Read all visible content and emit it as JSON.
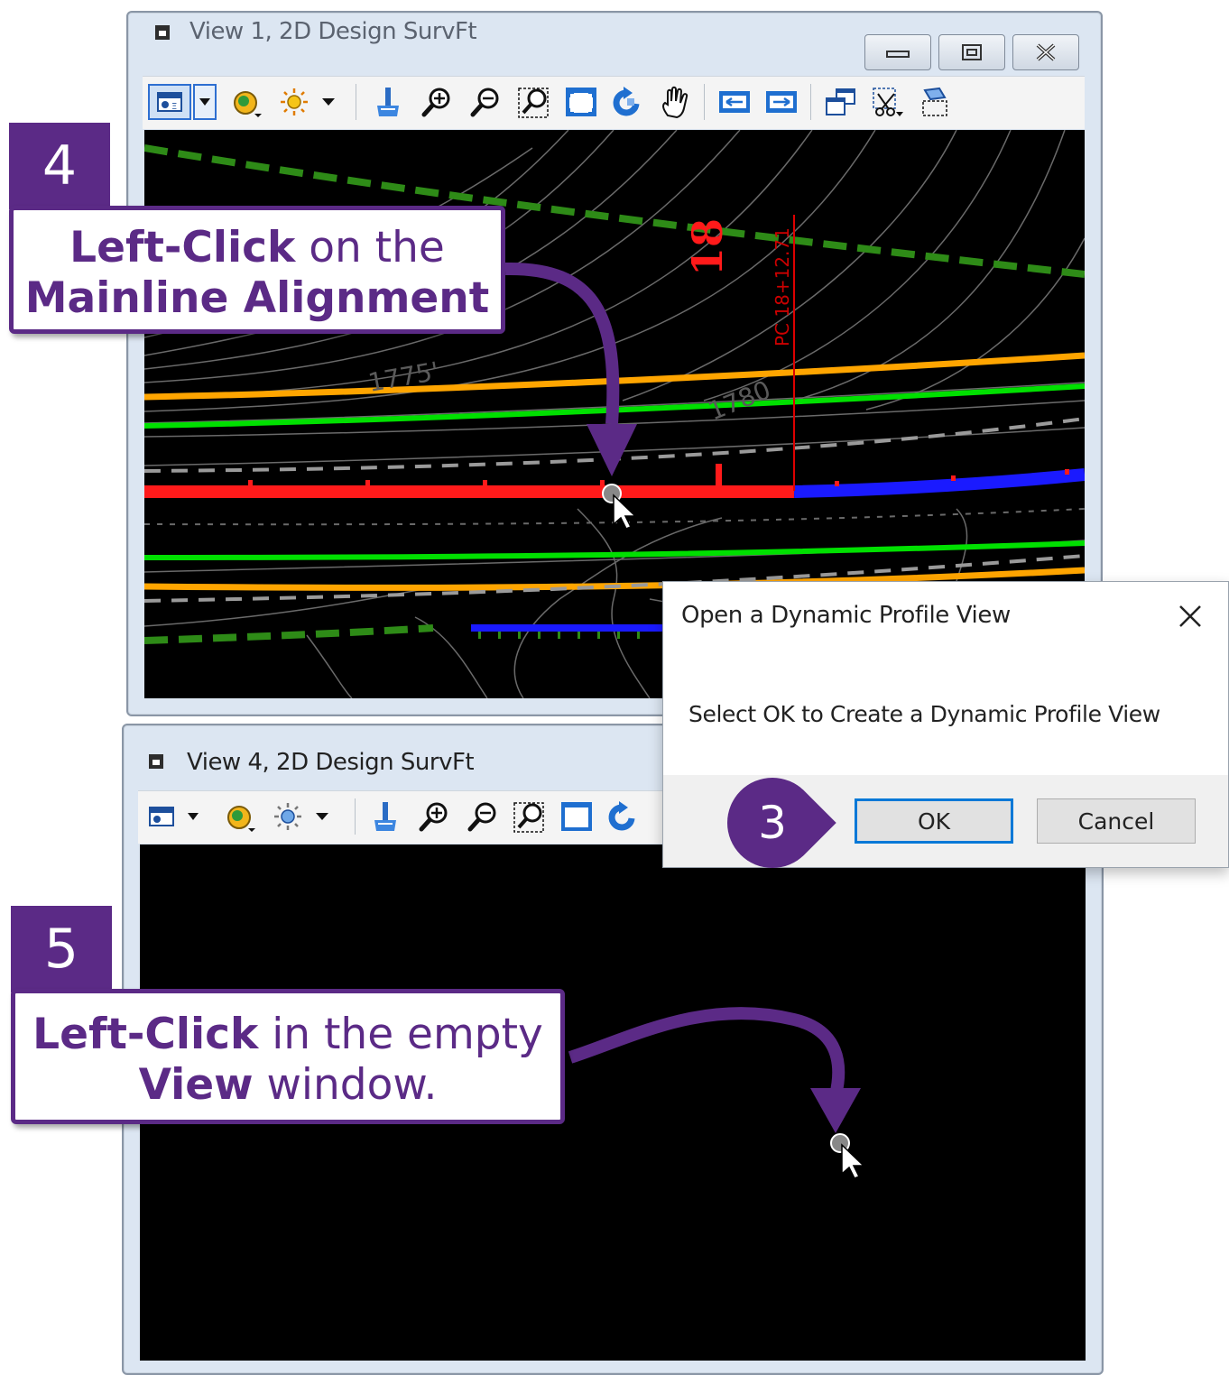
{
  "view1": {
    "title": "View 1, 2D Design SurvFt",
    "canvas_labels": {
      "station_number": "18",
      "pc_label": "PC 18+12.71",
      "contour_1775": "1775'",
      "contour_1780": "1780"
    }
  },
  "view4": {
    "title": "View 4, 2D Design SurvFt"
  },
  "caption_buttons": {
    "minimize": "minimize-icon",
    "restore": "restore-icon",
    "close": "close-icon"
  },
  "dialog": {
    "title": "Open a Dynamic Profile View",
    "message": "Select OK to Create a Dynamic Profile View",
    "ok_label": "OK",
    "cancel_label": "Cancel"
  },
  "callouts": {
    "step3": "3",
    "step4": {
      "number": "4",
      "bold1": "Left-Click",
      "text1": " on the",
      "bold2": "Mainline Alignment"
    },
    "step5": {
      "number": "5",
      "bold1": "Left-Click",
      "text1": " in the empty",
      "bold2": "View",
      "text2": " window."
    }
  },
  "colors": {
    "callout_purple": "#5b2a86",
    "alignment_red": "#ff1a1a",
    "alignment_blue": "#1a1aff",
    "edge_green": "#00e000",
    "edge_orange": "#ffa500",
    "row_green": "#2e8b17",
    "dialog_focus": "#0078d7"
  }
}
